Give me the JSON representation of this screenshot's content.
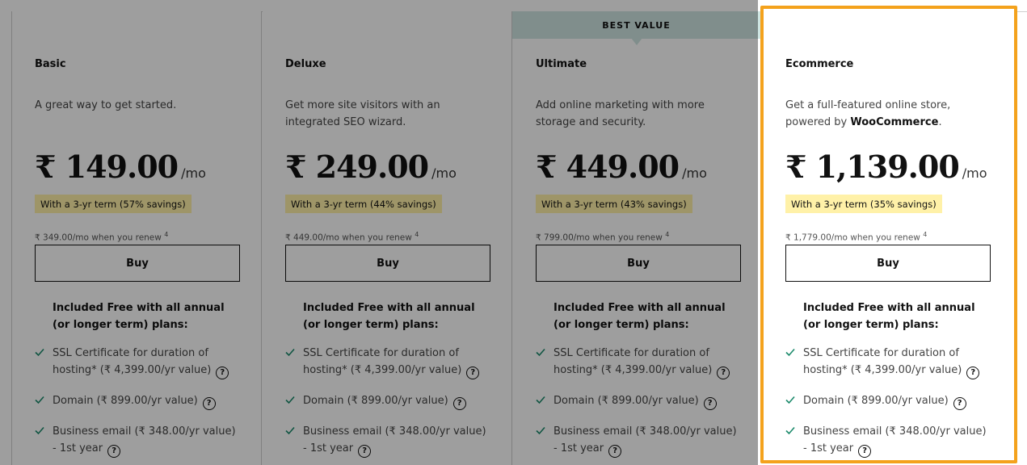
{
  "badge": {
    "label": "BEST VALUE"
  },
  "included_heading": "Included Free with all annual (or longer term) plans:",
  "buy_label": "Buy",
  "per_label": "/mo",
  "features": {
    "ssl": "SSL Certificate for duration of hosting* (₹ 4,399.00/yr value)",
    "domain": "Domain (₹ 899.00/yr value)",
    "email": "Business email (₹ 348.00/yr value) - 1st year"
  },
  "colors": {
    "highlight_border": "#f4a21c",
    "savings_bg": "#fff1a8",
    "badge_bg": "#cfe6e3",
    "check": "#1b8a6b"
  },
  "plans": [
    {
      "name": "Basic",
      "description": "A great way to get started.",
      "price": "₹ 149.00",
      "savings": "With a 3-yr term (57% savings)",
      "renew": "₹ 349.00/mo when you renew",
      "renew_sup": "4"
    },
    {
      "name": "Deluxe",
      "description": "Get more site visitors with an integrated SEO wizard.",
      "price": "₹ 249.00",
      "savings": "With a 3-yr term (44% savings)",
      "renew": "₹ 449.00/mo when you renew",
      "renew_sup": "4"
    },
    {
      "name": "Ultimate",
      "description": "Add online marketing with more storage and security.",
      "price": "₹ 449.00",
      "savings": "With a 3-yr term (43% savings)",
      "renew": "₹ 799.00/mo when you renew",
      "renew_sup": "4"
    },
    {
      "name": "Ecommerce",
      "description": "Get a full-featured online store, powered by",
      "description_bold": "WooCommerce",
      "description_end": ".",
      "price": "₹ 1,139.00",
      "savings": "With a 3-yr term (35% savings)",
      "renew": "₹ 1,779.00/mo when you renew",
      "renew_sup": "4"
    }
  ]
}
